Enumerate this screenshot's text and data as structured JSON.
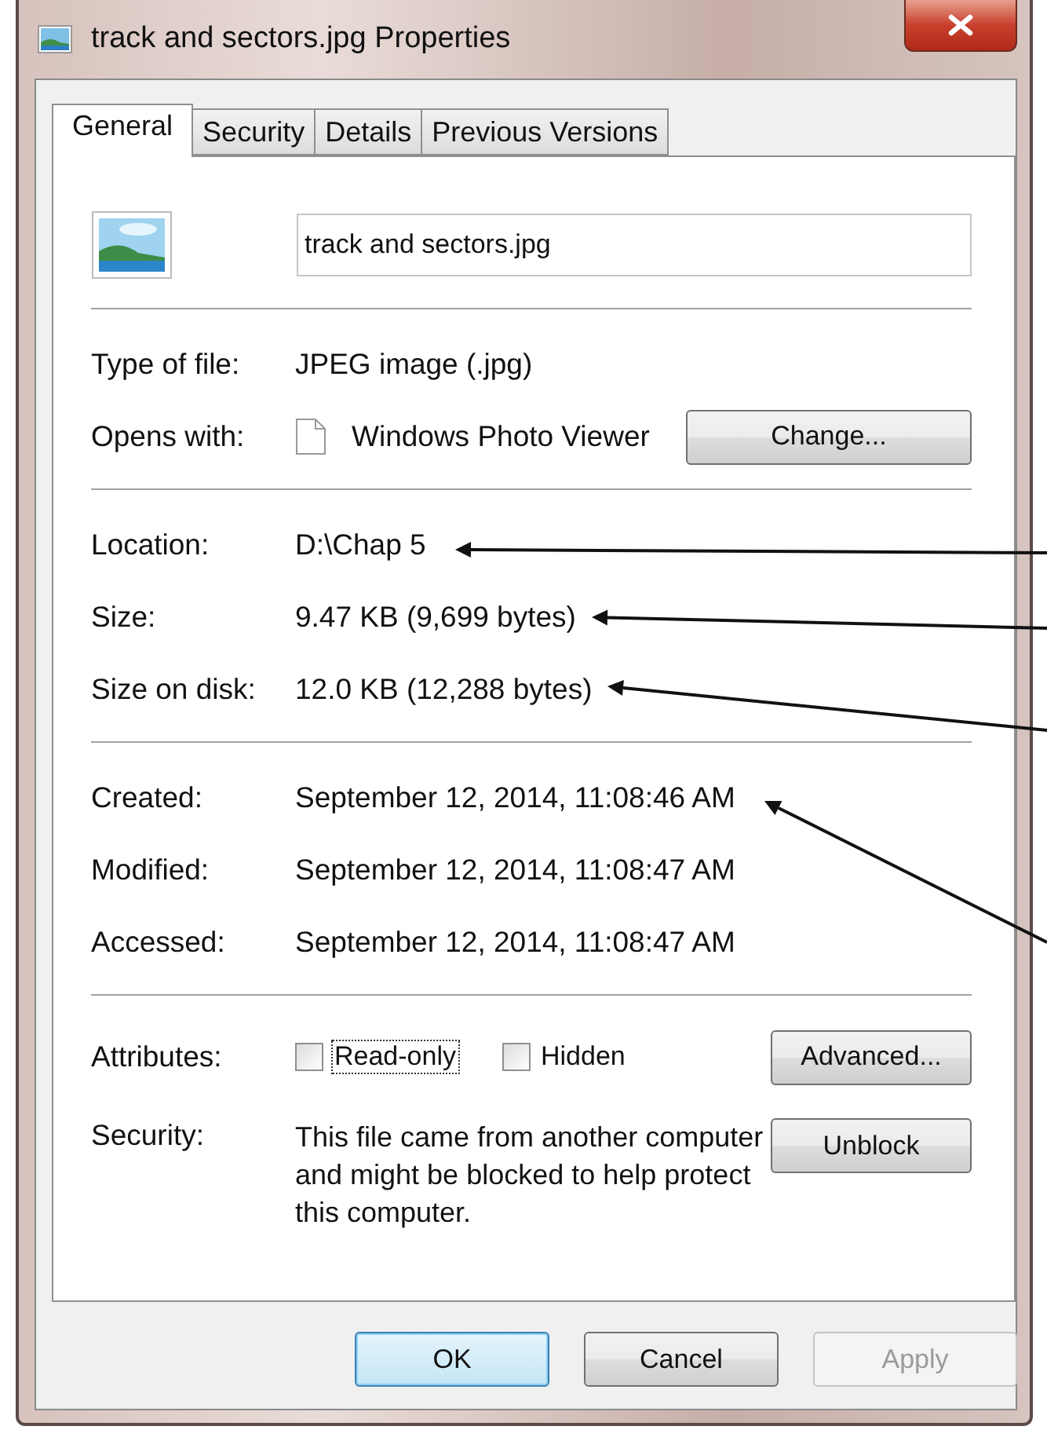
{
  "window": {
    "title": "track and sectors.jpg Properties"
  },
  "tabs": [
    {
      "label": "General",
      "selected": true
    },
    {
      "label": "Security",
      "selected": false
    },
    {
      "label": "Details",
      "selected": false
    },
    {
      "label": "Previous Versions",
      "selected": false
    }
  ],
  "file_name": {
    "value": "track and sectors.jpg"
  },
  "sections": [
    [
      {
        "kind": "text",
        "label": "Type of file:",
        "value": "JPEG image (.jpg)",
        "pointed": false
      },
      {
        "kind": "app",
        "label": "Opens with:",
        "value": "Windows Photo Viewer",
        "button": "Change...",
        "pointed": false
      }
    ],
    [
      {
        "kind": "text",
        "label": "Location:",
        "value": "D:\\Chap 5",
        "pointed": true
      },
      {
        "kind": "text",
        "label": "Size:",
        "value": "9.47 KB (9,699 bytes)",
        "pointed": true
      },
      {
        "kind": "text",
        "label": "Size on disk:",
        "value": "12.0 KB (12,288 bytes)",
        "pointed": true
      }
    ],
    [
      {
        "kind": "text",
        "label": "Created:",
        "value": "September 12, 2014, 11:08:46 AM",
        "pointed": true
      },
      {
        "kind": "text",
        "label": "Modified:",
        "value": "September 12, 2014, 11:08:47 AM",
        "pointed": false
      },
      {
        "kind": "text",
        "label": "Accessed:",
        "value": "September 12, 2014, 11:08:47 AM",
        "pointed": false
      }
    ]
  ],
  "attributes": {
    "label": "Attributes:",
    "options": [
      {
        "label": "Read-only",
        "checked": false,
        "focused": true
      },
      {
        "label": "Hidden",
        "checked": false,
        "focused": false
      }
    ],
    "button": "Advanced..."
  },
  "security": {
    "label": "Security:",
    "text": "This file came from another computer and might be blocked to help protect this computer.",
    "button": "Unblock"
  },
  "buttons": [
    {
      "label": "OK",
      "default": true,
      "disabled": false
    },
    {
      "label": "Cancel",
      "default": false,
      "disabled": false
    },
    {
      "label": "Apply",
      "default": false,
      "disabled": true
    }
  ]
}
